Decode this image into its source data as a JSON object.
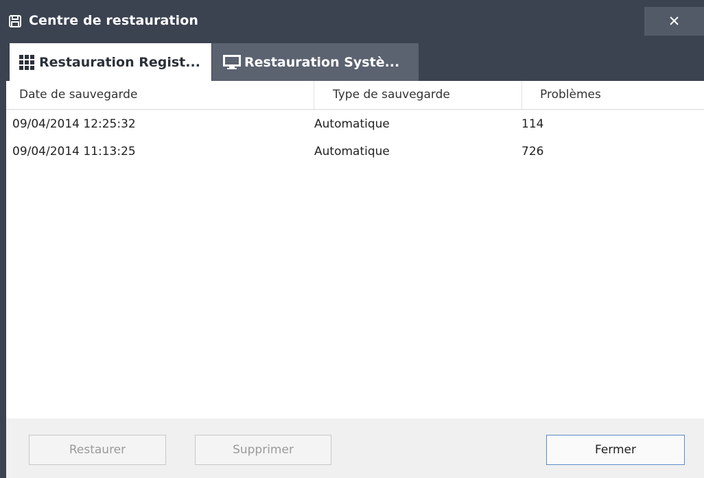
{
  "window": {
    "title": "Centre de restauration",
    "close_glyph": "✕",
    "title_icon": "floppy-disk-icon",
    "accent_color": "#3b4250"
  },
  "tabs": [
    {
      "label": "Restauration Regist...",
      "icon": "grid-icon",
      "active": true
    },
    {
      "label": "Restauration Systè...",
      "icon": "monitor-icon",
      "active": false
    }
  ],
  "table": {
    "columns": [
      "Date de sauvegarde",
      "Type de sauvegarde",
      "Problèmes"
    ],
    "rows": [
      {
        "date": "09/04/2014 12:25:32",
        "type": "Automatique",
        "problems": "114"
      },
      {
        "date": "09/04/2014 11:13:25",
        "type": "Automatique",
        "problems": "726"
      }
    ]
  },
  "footer": {
    "restore_label": "Restaurer",
    "delete_label": "Supprimer",
    "close_label": "Fermer"
  }
}
